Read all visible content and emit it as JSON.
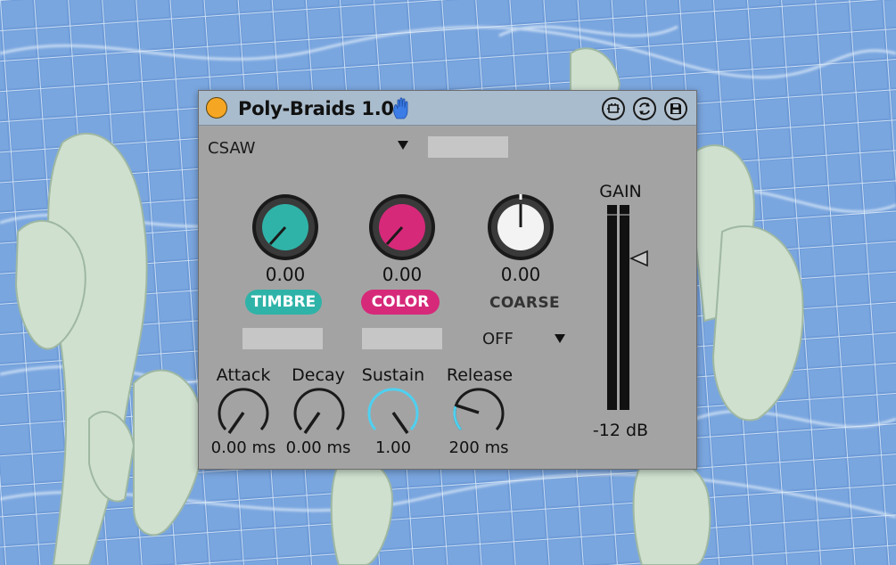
{
  "device": {
    "title": "Poly-Braids 1.0",
    "colors": {
      "power": "#f5a623",
      "timbre": "#2fb3a8",
      "color": "#d6297a",
      "sustain": "#4fd0f0",
      "panel": "#a3a3a3",
      "titlebar": "#a9bccd"
    },
    "titlebar_icons": [
      "hand-icon",
      "hotswap-icon",
      "refresh-icon",
      "save-icon"
    ]
  },
  "oscillator": {
    "shape_value": "CSAW"
  },
  "knobs": {
    "timbre": {
      "label": "TIMBRE",
      "value": "0.00"
    },
    "color": {
      "label": "COLOR",
      "value": "0.00"
    },
    "coarse": {
      "label": "COARSE",
      "value": "0.00"
    }
  },
  "mod_select": {
    "value": "OFF"
  },
  "envelope": {
    "attack": {
      "label": "Attack",
      "value": "0.00 ms"
    },
    "decay": {
      "label": "Decay",
      "value": "0.00 ms"
    },
    "sustain": {
      "label": "Sustain",
      "value": "1.00"
    },
    "release": {
      "label": "Release",
      "value": "200 ms"
    }
  },
  "gain": {
    "label": "GAIN",
    "value": "-12 dB"
  }
}
